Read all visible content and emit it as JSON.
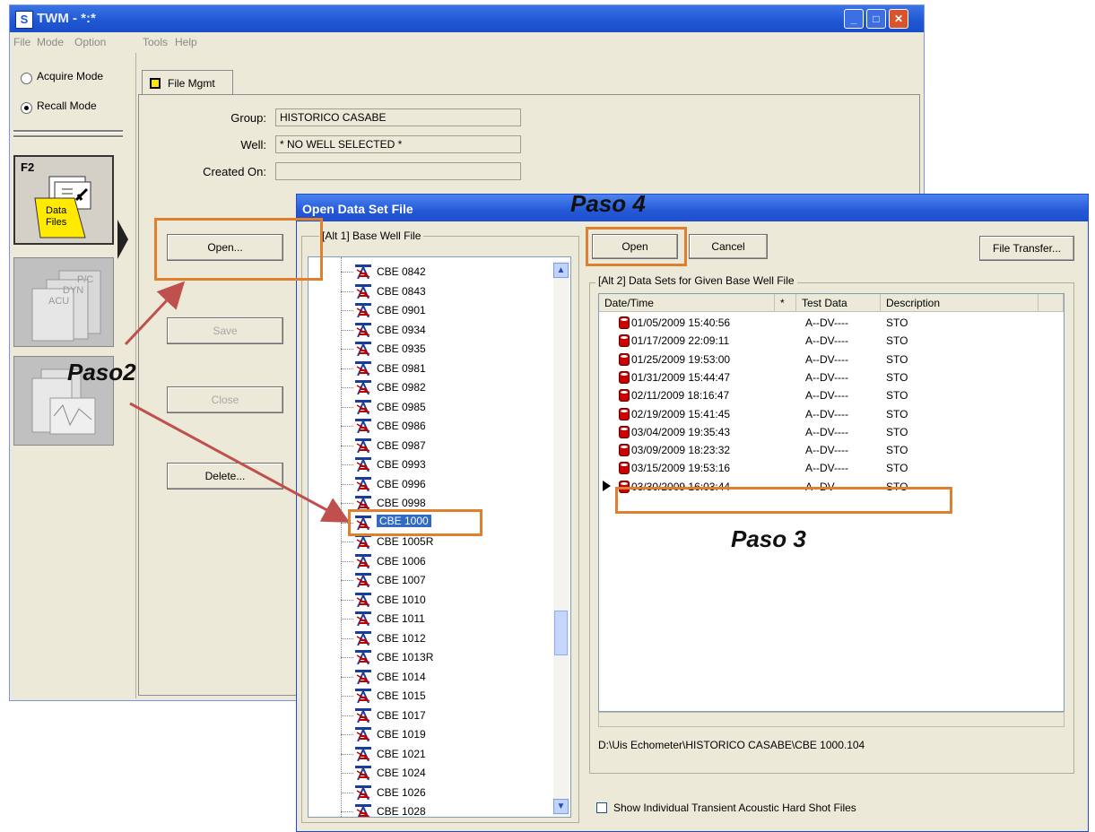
{
  "main_window": {
    "title": "TWM - *:*",
    "app_icon": "S",
    "menu": [
      "File",
      "Mode",
      "Option",
      "Tools",
      "Help"
    ],
    "modes": [
      {
        "label": "Acquire Mode",
        "selected": false
      },
      {
        "label": "Recall Mode",
        "selected": true
      }
    ],
    "tiles": {
      "data_files": {
        "key": "F2",
        "label_line1": "Data",
        "label_line2": "Files"
      },
      "pcdyn": {
        "line1": "P/C",
        "line2": "DYN",
        "line3": "ACU"
      }
    },
    "tab_label": "File Mgmt",
    "fields": {
      "group_label": "Group:",
      "group_value": "HISTORICO CASABE",
      "well_label": "Well:",
      "well_value": "* NO WELL SELECTED *",
      "created_label": "Created On:",
      "created_value": ""
    },
    "buttons": {
      "open": "Open...",
      "save": "Save",
      "close": "Close",
      "delete": "Delete..."
    }
  },
  "dialog": {
    "title": "Open Data Set File",
    "tree_group_label": "[Alt 1]  Base Well File",
    "list_group_label": "[Alt 2]  Data Sets for Given Base Well File",
    "buttons": {
      "open": "Open",
      "cancel": "Cancel",
      "file_transfer": "File Transfer..."
    },
    "tree_items": [
      "CBE 0842",
      "CBE 0843",
      "CBE 0901",
      "CBE 0934",
      "CBE 0935",
      "CBE 0981",
      "CBE 0982",
      "CBE 0985",
      "CBE 0986",
      "CBE 0987",
      "CBE 0993",
      "CBE 0996",
      "CBE 0998",
      "CBE 1000",
      "CBE 1005R",
      "CBE 1006",
      "CBE 1007",
      "CBE 1010",
      "CBE 1011",
      "CBE 1012",
      "CBE 1013R",
      "CBE 1014",
      "CBE 1015",
      "CBE 1017",
      "CBE 1019",
      "CBE 1021",
      "CBE 1024",
      "CBE 1026",
      "CBE 1028"
    ],
    "selected_tree_item": "CBE 1000",
    "columns": [
      "Date/Time",
      "*",
      "Test Data",
      "Description"
    ],
    "rows": [
      {
        "datetime": "01/05/2009  15:40:56",
        "test": "A--DV----",
        "desc": "STO"
      },
      {
        "datetime": "01/17/2009  22:09:11",
        "test": "A--DV----",
        "desc": "STO"
      },
      {
        "datetime": "01/25/2009  19:53:00",
        "test": "A--DV----",
        "desc": "STO"
      },
      {
        "datetime": "01/31/2009  15:44:47",
        "test": "A--DV----",
        "desc": "STO"
      },
      {
        "datetime": "02/11/2009  18:16:47",
        "test": "A--DV----",
        "desc": "STO"
      },
      {
        "datetime": "02/19/2009  15:41:45",
        "test": "A--DV----",
        "desc": "STO"
      },
      {
        "datetime": "03/04/2009  19:35:43",
        "test": "A--DV----",
        "desc": "STO"
      },
      {
        "datetime": "03/09/2009  18:23:32",
        "test": "A--DV----",
        "desc": "STO"
      },
      {
        "datetime": "03/15/2009  19:53:16",
        "test": "A--DV----",
        "desc": "STO"
      },
      {
        "datetime": "03/30/2009  16:03:44",
        "test": "A--DV----",
        "desc": "STO"
      }
    ],
    "path": "D:\\Uis Echometer\\HISTORICO CASABE\\CBE 1000.104",
    "checkbox_label": "Show Individual Transient Acoustic Hard Shot Files"
  },
  "annotations": {
    "paso2": "Paso2",
    "paso3": "Paso 3",
    "paso4": "Paso 4"
  },
  "colors": {
    "highlight": "#e07f2d",
    "titlebar": "#2558d8",
    "window_bg": "#ece9d8",
    "selection": "#316ac5"
  }
}
